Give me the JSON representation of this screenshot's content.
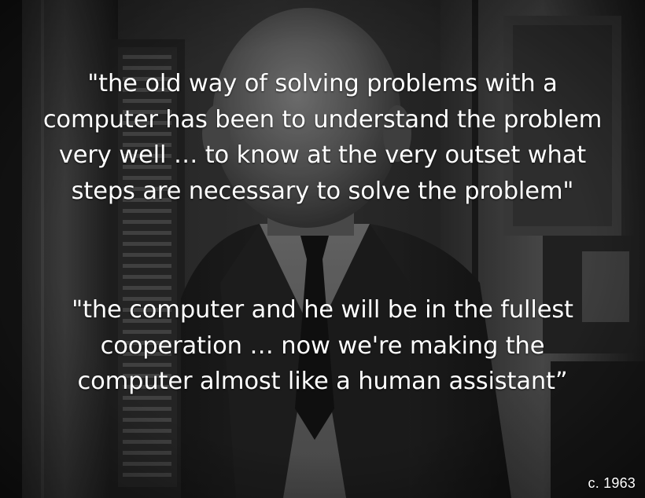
{
  "quotes": [
    {
      "lines": [
        "\"the old way of solving problems with a",
        "computer has been to understand the problem",
        "very well … to know at the very outset what",
        "steps are necessary to solve the problem\""
      ]
    },
    {
      "lines": [
        "\"the computer and he will be in the fullest",
        "cooperation … now we're making the",
        "computer almost like a human assistant”"
      ]
    }
  ],
  "date_label": "c. 1963"
}
